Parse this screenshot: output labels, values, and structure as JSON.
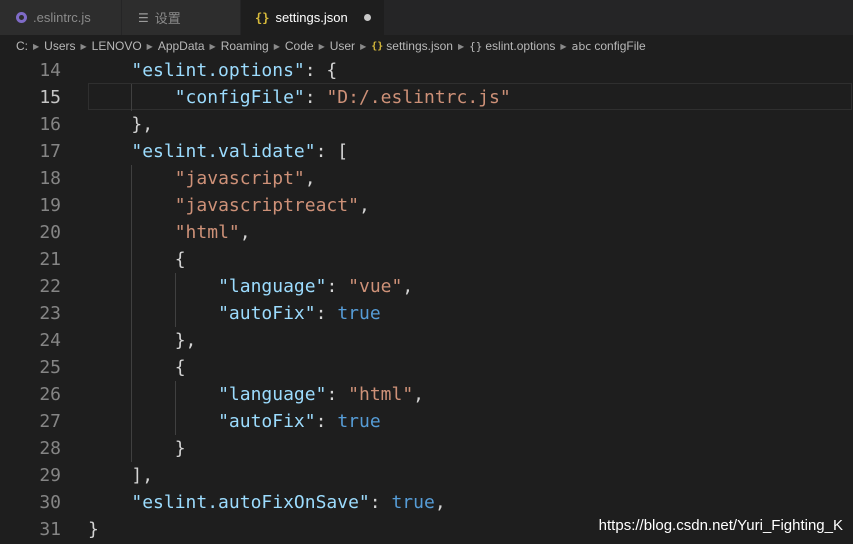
{
  "tabs": [
    {
      "label": ".eslintrc.js",
      "icon": "eslint-icon",
      "active": false
    },
    {
      "label": "设置",
      "icon": "settings-icon",
      "active": false
    },
    {
      "label": "settings.json",
      "icon": "json-icon",
      "active": true,
      "dirty": true
    }
  ],
  "breadcrumb": [
    {
      "label": "C:"
    },
    {
      "label": "Users"
    },
    {
      "label": "LENOVO"
    },
    {
      "label": "AppData"
    },
    {
      "label": "Roaming"
    },
    {
      "label": "Code"
    },
    {
      "label": "User"
    },
    {
      "label": "settings.json",
      "icon": "json-icon"
    },
    {
      "label": "eslint.options",
      "icon": "object-icon"
    },
    {
      "label": "configFile",
      "icon": "string-icon"
    }
  ],
  "editor": {
    "current_line": "15",
    "lines": [
      {
        "n": "14",
        "indent": 1,
        "tokens": [
          [
            "k",
            "\"eslint.options\""
          ],
          [
            "p",
            ": {"
          ]
        ]
      },
      {
        "n": "15",
        "indent": 2,
        "tokens": [
          [
            "k",
            "\"configFile\""
          ],
          [
            "p",
            ": "
          ],
          [
            "s",
            "\"D:/.eslintrc.js\""
          ]
        ]
      },
      {
        "n": "16",
        "indent": 1,
        "tokens": [
          [
            "p",
            "},"
          ]
        ]
      },
      {
        "n": "17",
        "indent": 1,
        "tokens": [
          [
            "k",
            "\"eslint.validate\""
          ],
          [
            "p",
            ": ["
          ]
        ]
      },
      {
        "n": "18",
        "indent": 2,
        "tokens": [
          [
            "s",
            "\"javascript\""
          ],
          [
            "p",
            ","
          ]
        ]
      },
      {
        "n": "19",
        "indent": 2,
        "tokens": [
          [
            "s",
            "\"javascriptreact\""
          ],
          [
            "p",
            ","
          ]
        ]
      },
      {
        "n": "20",
        "indent": 2,
        "tokens": [
          [
            "s",
            "\"html\""
          ],
          [
            "p",
            ","
          ]
        ]
      },
      {
        "n": "21",
        "indent": 2,
        "tokens": [
          [
            "p",
            "{"
          ]
        ]
      },
      {
        "n": "22",
        "indent": 3,
        "tokens": [
          [
            "k",
            "\"language\""
          ],
          [
            "p",
            ": "
          ],
          [
            "s",
            "\"vue\""
          ],
          [
            "p",
            ","
          ]
        ]
      },
      {
        "n": "23",
        "indent": 3,
        "tokens": [
          [
            "k",
            "\"autoFix\""
          ],
          [
            "p",
            ": "
          ],
          [
            "b",
            "true"
          ]
        ]
      },
      {
        "n": "24",
        "indent": 2,
        "tokens": [
          [
            "p",
            "},"
          ]
        ]
      },
      {
        "n": "25",
        "indent": 2,
        "tokens": [
          [
            "p",
            "{"
          ]
        ]
      },
      {
        "n": "26",
        "indent": 3,
        "tokens": [
          [
            "k",
            "\"language\""
          ],
          [
            "p",
            ": "
          ],
          [
            "s",
            "\"html\""
          ],
          [
            "p",
            ","
          ]
        ]
      },
      {
        "n": "27",
        "indent": 3,
        "tokens": [
          [
            "k",
            "\"autoFix\""
          ],
          [
            "p",
            ": "
          ],
          [
            "b",
            "true"
          ]
        ]
      },
      {
        "n": "28",
        "indent": 2,
        "tokens": [
          [
            "p",
            "}"
          ]
        ]
      },
      {
        "n": "29",
        "indent": 1,
        "tokens": [
          [
            "p",
            "],"
          ]
        ]
      },
      {
        "n": "30",
        "indent": 1,
        "tokens": [
          [
            "k",
            "\"eslint.autoFixOnSave\""
          ],
          [
            "p",
            ": "
          ],
          [
            "b",
            "true"
          ],
          [
            "p",
            ","
          ]
        ]
      },
      {
        "n": "31",
        "indent": 0,
        "tokens": [
          [
            "p",
            "}"
          ]
        ]
      }
    ]
  },
  "watermark": "https://blog.csdn.net/Yuri_Fighting_K",
  "colors": {
    "background": "#1e1e1e",
    "key": "#9cdcfe",
    "string": "#ce9178",
    "boolean": "#569cd6",
    "punctuation": "#d4d4d4"
  }
}
